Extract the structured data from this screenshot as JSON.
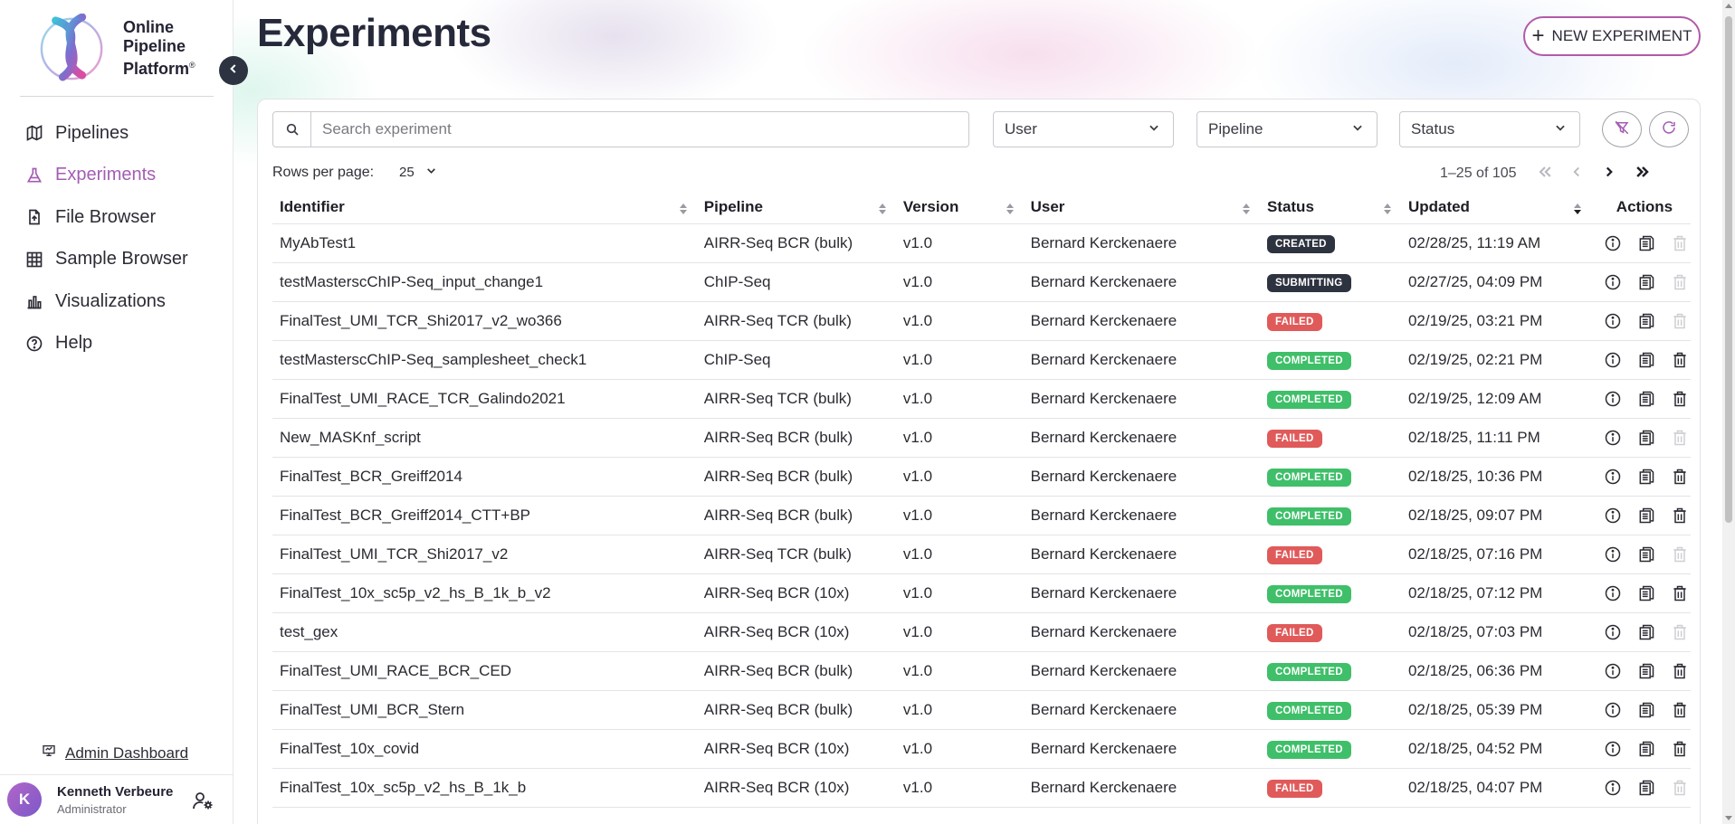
{
  "app": {
    "logo_lines": [
      "Online",
      "Pipeline",
      "Platform"
    ],
    "logo_mark_sup": "®"
  },
  "sidebar": {
    "items": [
      {
        "label": "Pipelines",
        "icon": "map-icon",
        "active": false
      },
      {
        "label": "Experiments",
        "icon": "flask-icon",
        "active": true
      },
      {
        "label": "File Browser",
        "icon": "file-upload-icon",
        "active": false
      },
      {
        "label": "Sample Browser",
        "icon": "grid-icon",
        "active": false
      },
      {
        "label": "Visualizations",
        "icon": "bar-chart-icon",
        "active": false
      },
      {
        "label": "Help",
        "icon": "help-circle-icon",
        "active": false
      }
    ],
    "admin_link": "Admin Dashboard",
    "user": {
      "initial": "K",
      "name": "Kenneth Verbeure",
      "role": "Administrator"
    }
  },
  "header": {
    "title": "Experiments",
    "new_button": "NEW EXPERIMENT"
  },
  "filters": {
    "search_placeholder": "Search experiment",
    "user_select": "User",
    "pipeline_select": "Pipeline",
    "status_select": "Status"
  },
  "pagination": {
    "rows_label": "Rows per page:",
    "rows_value": "25",
    "range": "1–25 of 105"
  },
  "table": {
    "columns": [
      "Identifier",
      "Pipeline",
      "Version",
      "User",
      "Status",
      "Updated",
      "Actions"
    ],
    "rows": [
      {
        "id": "MyAbTest1",
        "pipeline": "AIRR-Seq BCR (bulk)",
        "version": "v1.0",
        "user": "Bernard Kerckenaere",
        "status": "CREATED",
        "updated": "02/28/25, 11:19 AM",
        "deletable": false
      },
      {
        "id": "testMasterscChIP-Seq_input_change1",
        "pipeline": "ChIP-Seq",
        "version": "v1.0",
        "user": "Bernard Kerckenaere",
        "status": "SUBMITTING",
        "updated": "02/27/25, 04:09 PM",
        "deletable": false
      },
      {
        "id": "FinalTest_UMI_TCR_Shi2017_v2_wo366",
        "pipeline": "AIRR-Seq TCR (bulk)",
        "version": "v1.0",
        "user": "Bernard Kerckenaere",
        "status": "FAILED",
        "updated": "02/19/25, 03:21 PM",
        "deletable": false
      },
      {
        "id": "testMasterscChIP-Seq_samplesheet_check1",
        "pipeline": "ChIP-Seq",
        "version": "v1.0",
        "user": "Bernard Kerckenaere",
        "status": "COMPLETED",
        "updated": "02/19/25, 02:21 PM",
        "deletable": true
      },
      {
        "id": "FinalTest_UMI_RACE_TCR_Galindo2021",
        "pipeline": "AIRR-Seq TCR (bulk)",
        "version": "v1.0",
        "user": "Bernard Kerckenaere",
        "status": "COMPLETED",
        "updated": "02/19/25, 12:09 AM",
        "deletable": true
      },
      {
        "id": "New_MASKnf_script",
        "pipeline": "AIRR-Seq BCR (bulk)",
        "version": "v1.0",
        "user": "Bernard Kerckenaere",
        "status": "FAILED",
        "updated": "02/18/25, 11:11 PM",
        "deletable": false
      },
      {
        "id": "FinalTest_BCR_Greiff2014",
        "pipeline": "AIRR-Seq BCR (bulk)",
        "version": "v1.0",
        "user": "Bernard Kerckenaere",
        "status": "COMPLETED",
        "updated": "02/18/25, 10:36 PM",
        "deletable": true
      },
      {
        "id": "FinalTest_BCR_Greiff2014_CTT+BP",
        "pipeline": "AIRR-Seq BCR (bulk)",
        "version": "v1.0",
        "user": "Bernard Kerckenaere",
        "status": "COMPLETED",
        "updated": "02/18/25, 09:07 PM",
        "deletable": true
      },
      {
        "id": "FinalTest_UMI_TCR_Shi2017_v2",
        "pipeline": "AIRR-Seq TCR (bulk)",
        "version": "v1.0",
        "user": "Bernard Kerckenaere",
        "status": "FAILED",
        "updated": "02/18/25, 07:16 PM",
        "deletable": false
      },
      {
        "id": "FinalTest_10x_sc5p_v2_hs_B_1k_b_v2",
        "pipeline": "AIRR-Seq BCR (10x)",
        "version": "v1.0",
        "user": "Bernard Kerckenaere",
        "status": "COMPLETED",
        "updated": "02/18/25, 07:12 PM",
        "deletable": true
      },
      {
        "id": "test_gex",
        "pipeline": "AIRR-Seq BCR (10x)",
        "version": "v1.0",
        "user": "Bernard Kerckenaere",
        "status": "FAILED",
        "updated": "02/18/25, 07:03 PM",
        "deletable": false
      },
      {
        "id": "FinalTest_UMI_RACE_BCR_CED",
        "pipeline": "AIRR-Seq BCR (bulk)",
        "version": "v1.0",
        "user": "Bernard Kerckenaere",
        "status": "COMPLETED",
        "updated": "02/18/25, 06:36 PM",
        "deletable": true
      },
      {
        "id": "FinalTest_UMI_BCR_Stern",
        "pipeline": "AIRR-Seq BCR (bulk)",
        "version": "v1.0",
        "user": "Bernard Kerckenaere",
        "status": "COMPLETED",
        "updated": "02/18/25, 05:39 PM",
        "deletable": true
      },
      {
        "id": "FinalTest_10x_covid",
        "pipeline": "AIRR-Seq BCR (10x)",
        "version": "v1.0",
        "user": "Bernard Kerckenaere",
        "status": "COMPLETED",
        "updated": "02/18/25, 04:52 PM",
        "deletable": true
      },
      {
        "id": "FinalTest_10x_sc5p_v2_hs_B_1k_b",
        "pipeline": "AIRR-Seq BCR (10x)",
        "version": "v1.0",
        "user": "Bernard Kerckenaere",
        "status": "FAILED",
        "updated": "02/18/25, 04:07 PM",
        "deletable": false
      }
    ]
  },
  "colors": {
    "accent": "#a35db3",
    "created": "#2e3340",
    "submitting": "#2e3340",
    "failed": "#e05a5a",
    "completed": "#3fbf69"
  }
}
